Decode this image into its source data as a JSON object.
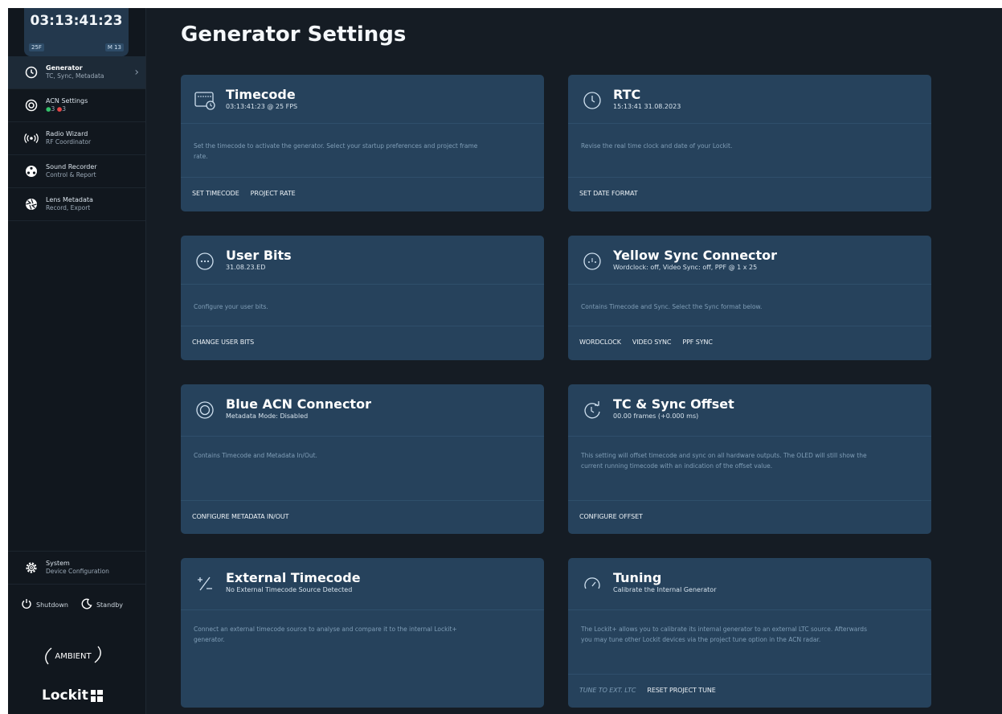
{
  "clock": {
    "time": "03:13:41:23",
    "fps": "25F",
    "mode": "M 13"
  },
  "nav": [
    {
      "title": "Generator",
      "sub": "TC, Sync, Metadata",
      "icon": "clock-icon"
    },
    {
      "title": "ACN Settings",
      "dots": [
        "3",
        "3"
      ],
      "icon": "acn-icon"
    },
    {
      "title": "Radio Wizard",
      "sub": "RF Coordinator",
      "icon": "radio-icon"
    },
    {
      "title": "Sound Recorder",
      "sub": "Control & Report",
      "icon": "reel-icon"
    },
    {
      "title": "Lens Metadata",
      "sub": "Record, Export",
      "icon": "aperture-icon"
    }
  ],
  "system": {
    "title": "System",
    "sub": "Device Configuration",
    "icon": "gear-icon"
  },
  "power": {
    "shutdown": "Shutdown",
    "standby": "Standby"
  },
  "brand": {
    "ambient": "AMBIENT",
    "lockit": "Lockit"
  },
  "page_title": "Generator Settings",
  "cards": [
    {
      "title": "Timecode",
      "sub": "03:13:41:23 @ 25 FPS",
      "desc": "Set the timecode to activate the generator. Select your startup preferences and project frame rate.",
      "actions": [
        "SET TIMECODE",
        "PROJECT RATE"
      ],
      "icon": "timecode-icon"
    },
    {
      "title": "RTC",
      "sub": "15:13:41 31.08.2023",
      "desc": "Revise the real time clock and date of your Lockit.",
      "actions": [
        "SET DATE FORMAT"
      ],
      "icon": "clock-icon"
    },
    {
      "title": "User Bits",
      "sub": "31.08.23.ED",
      "desc": "Configure your user bits.",
      "actions": [
        "CHANGE USER BITS"
      ],
      "icon": "ellipsis-icon"
    },
    {
      "title": "Yellow Sync Connector",
      "sub": "Wordclock: off, Video Sync: off, PPF @ 1 x 25",
      "desc": "Contains Timecode and Sync. Select the Sync format below.",
      "actions": [
        "WORDCLOCK",
        "VIDEO SYNC",
        "PPF SYNC"
      ],
      "icon": "connector-icon"
    },
    {
      "title": "Blue ACN Connector",
      "sub": "Metadata Mode: Disabled",
      "desc": "Contains Timecode and Metadata In/Out.",
      "actions": [
        "CONFIGURE METADATA IN/OUT"
      ],
      "icon": "acn-icon"
    },
    {
      "title": "TC & Sync Offset",
      "sub": "00.00 frames (+0.000 ms)",
      "desc": "This setting will offset timecode and sync on all hardware outputs. The OLED will still show the current running timecode with an indication of the offset value.",
      "actions": [
        "CONFIGURE OFFSET"
      ],
      "icon": "offset-icon"
    },
    {
      "title": "External Timecode",
      "sub": "No External Timecode Source Detected",
      "desc": "Connect an external timecode source to analyse and compare it to the internal Lockit+ generator.",
      "actions": [],
      "icon": "plus-minus-icon"
    },
    {
      "title": "Tuning",
      "sub": "Calibrate the Internal Generator",
      "desc": "The Lockit+ allows you to calibrate its internal generator to an external LTC source. Afterwards you may tune other Lockit devices via the project tune option in the ACN radar.",
      "actions": [
        "TUNE TO EXT. LTC",
        "RESET PROJECT TUNE"
      ],
      "icon": "gauge-icon"
    }
  ]
}
